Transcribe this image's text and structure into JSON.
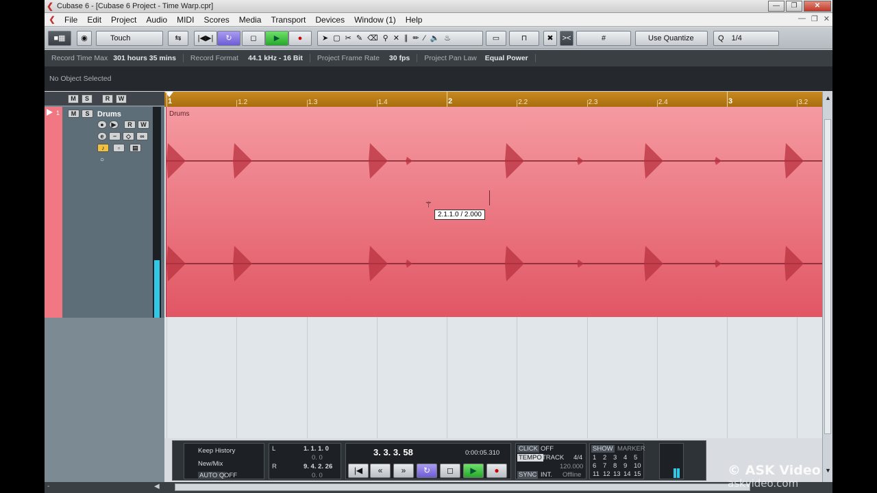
{
  "window": {
    "title": "Cubase 6 - [Cubase 6 Project - Time Warp.cpr]"
  },
  "menu": [
    "File",
    "Edit",
    "Project",
    "Audio",
    "MIDI",
    "Scores",
    "Media",
    "Transport",
    "Devices",
    "Window (1)",
    "Help"
  ],
  "toolbar": {
    "automation_mode": "Touch",
    "quantize_mode": "Use Quantize",
    "quantize_value": "1/4",
    "quantize_prefix": "Q"
  },
  "infoline": [
    {
      "label": "Record Time Max",
      "value": "301 hours 35 mins"
    },
    {
      "label": "Record Format",
      "value": "44.1 kHz - 16 Bit"
    },
    {
      "label": "Project Frame Rate",
      "value": "30 fps"
    },
    {
      "label": "Project Pan Law",
      "value": "Equal Power"
    }
  ],
  "inspector": {
    "status": "No Object Selected"
  },
  "track": {
    "number": "1",
    "name": "Drums",
    "mute": "M",
    "solo": "S",
    "read": "R",
    "write": "W"
  },
  "ruler": {
    "labels": [
      "1",
      "1.2",
      "1.3",
      "1.4",
      "2",
      "2.2",
      "2.3",
      "2.4",
      "3",
      "3.2"
    ]
  },
  "event": {
    "name": "Drums"
  },
  "tooltip": {
    "text": "2.1.1.0 / 2.000"
  },
  "transport": {
    "keep_history": "Keep History",
    "new_mix": "New/Mix",
    "auto_q": "AUTO Q",
    "auto_q_state": "OFF",
    "left_locator": "1. 1. 1.   0",
    "left_sub": "0.   0",
    "right_locator": "9. 4. 2. 26",
    "right_sub": "0.   0",
    "position_bars": "3.  3.  3.  58",
    "position_time": "0:00:05.310",
    "click_label": "CLICK",
    "click_state": "OFF",
    "tempo_label": "TEMPO",
    "tempo_mode": "TRACK",
    "signature": "4/4",
    "tempo_value": "120.000",
    "sync_label": "SYNC",
    "sync_mode": "INT.",
    "sync_state": "Offline",
    "show_label": "SHOW",
    "marker_label": "MARKER",
    "markers": [
      "1",
      "2",
      "3",
      "4",
      "5",
      "6",
      "7",
      "8",
      "9",
      "10",
      "11",
      "12",
      "13",
      "14",
      "15"
    ]
  },
  "watermark": {
    "line1": "© ASK Video",
    "line2": "askvideo.com"
  }
}
